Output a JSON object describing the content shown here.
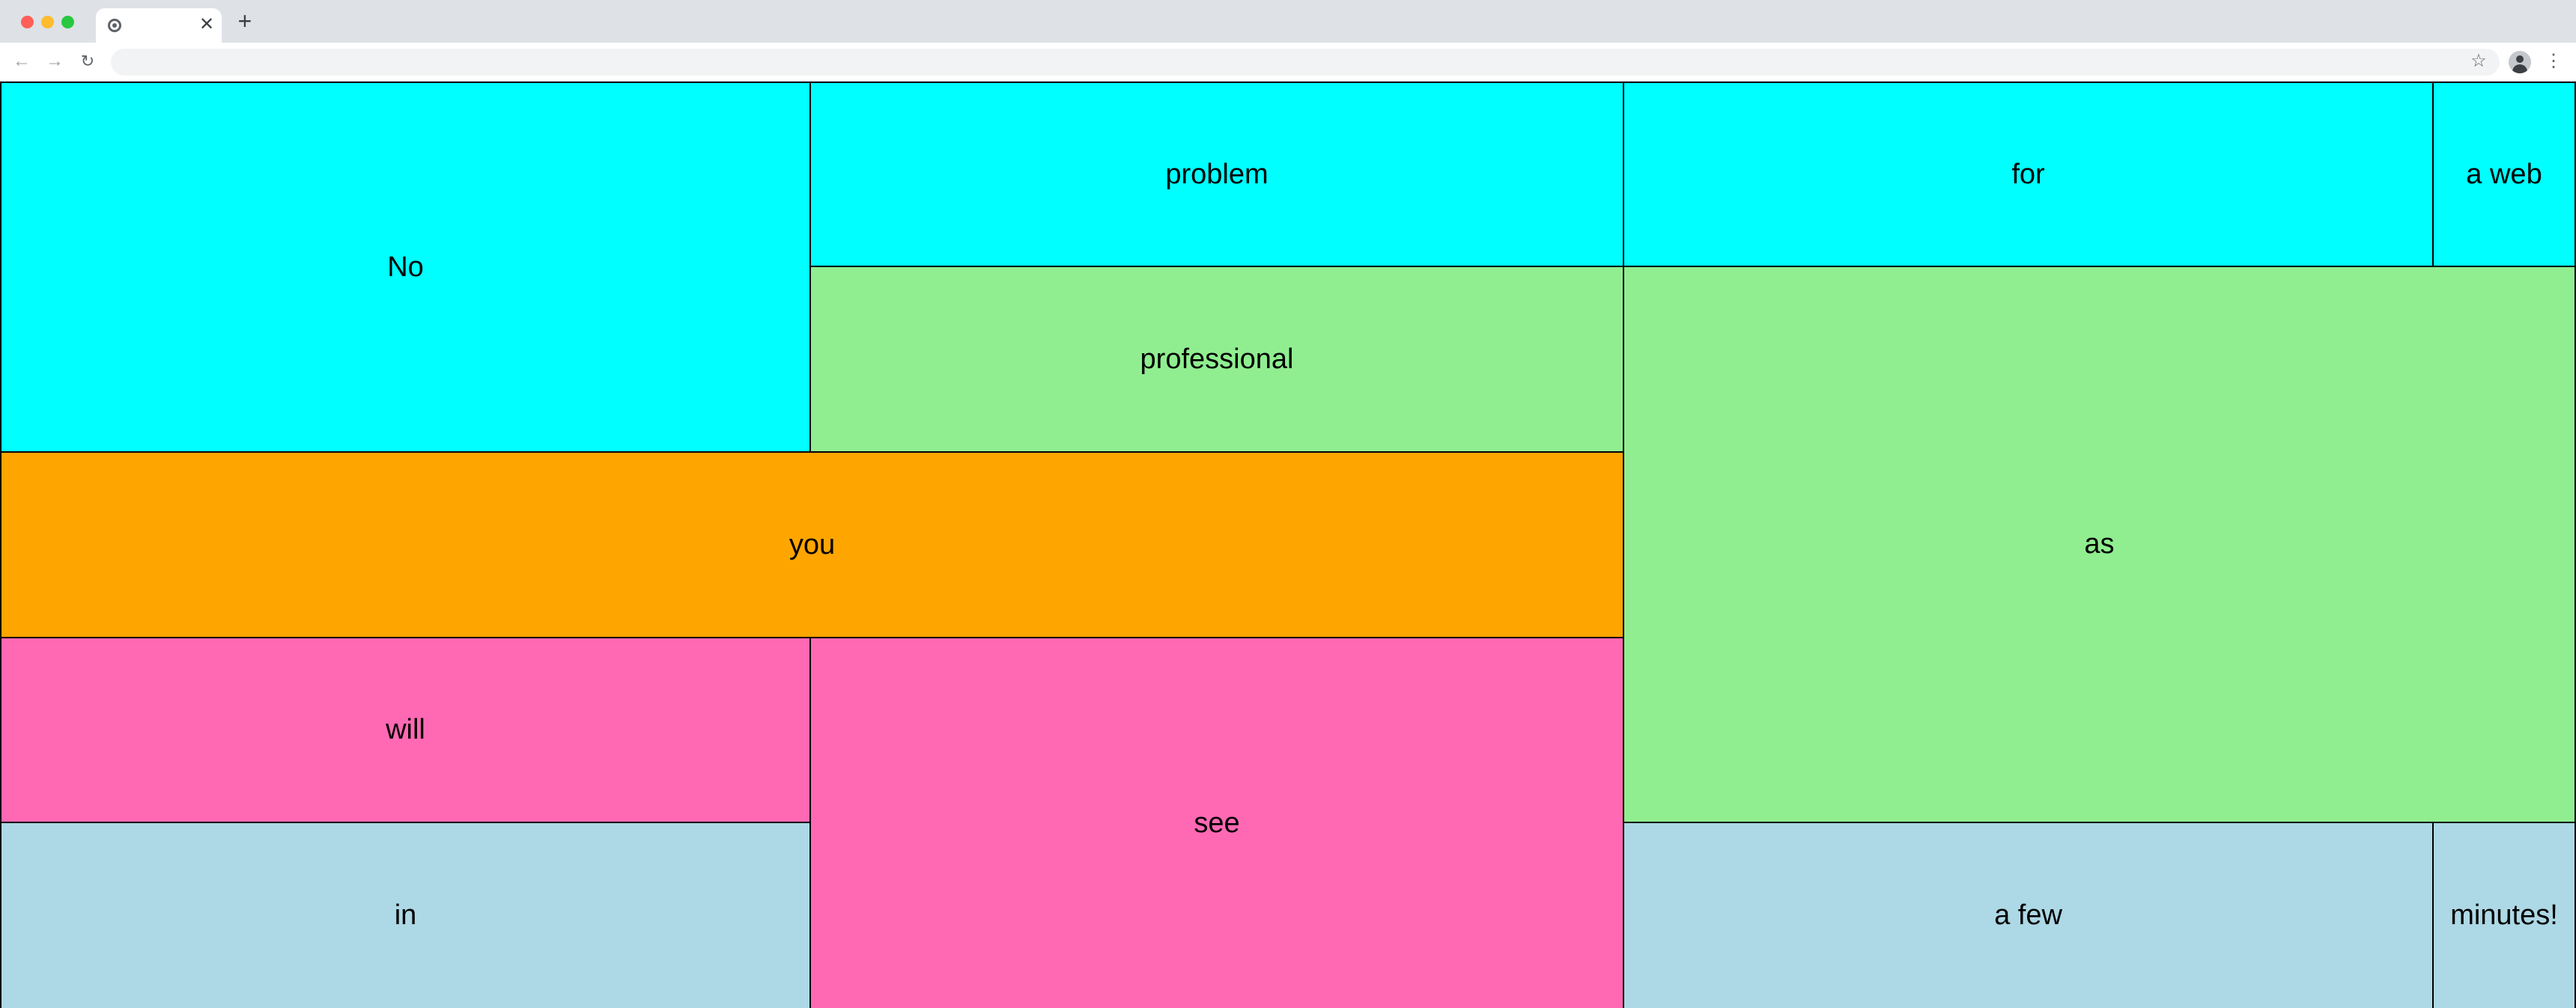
{
  "browser": {
    "tab_title": "",
    "tab_close_glyph": "✕",
    "new_tab_glyph": "+",
    "back_glyph": "←",
    "forward_glyph": "→",
    "reload_glyph": "↻",
    "address_value": "",
    "star_glyph": "☆",
    "menu_glyph": "⋮"
  },
  "colors": {
    "cyan": "#00ffff",
    "green": "#90ee90",
    "orange": "#ffa500",
    "pink": "#ff69b4",
    "blue": "#add8e6"
  },
  "grid": {
    "cells": {
      "no": "No",
      "problem": "problem",
      "for": "for",
      "a_web": "a web",
      "professional": "professional",
      "as": "as",
      "you": "you",
      "will": "will",
      "see": "see",
      "in": "in",
      "a_few": "a few",
      "minutes": "minutes!"
    }
  }
}
